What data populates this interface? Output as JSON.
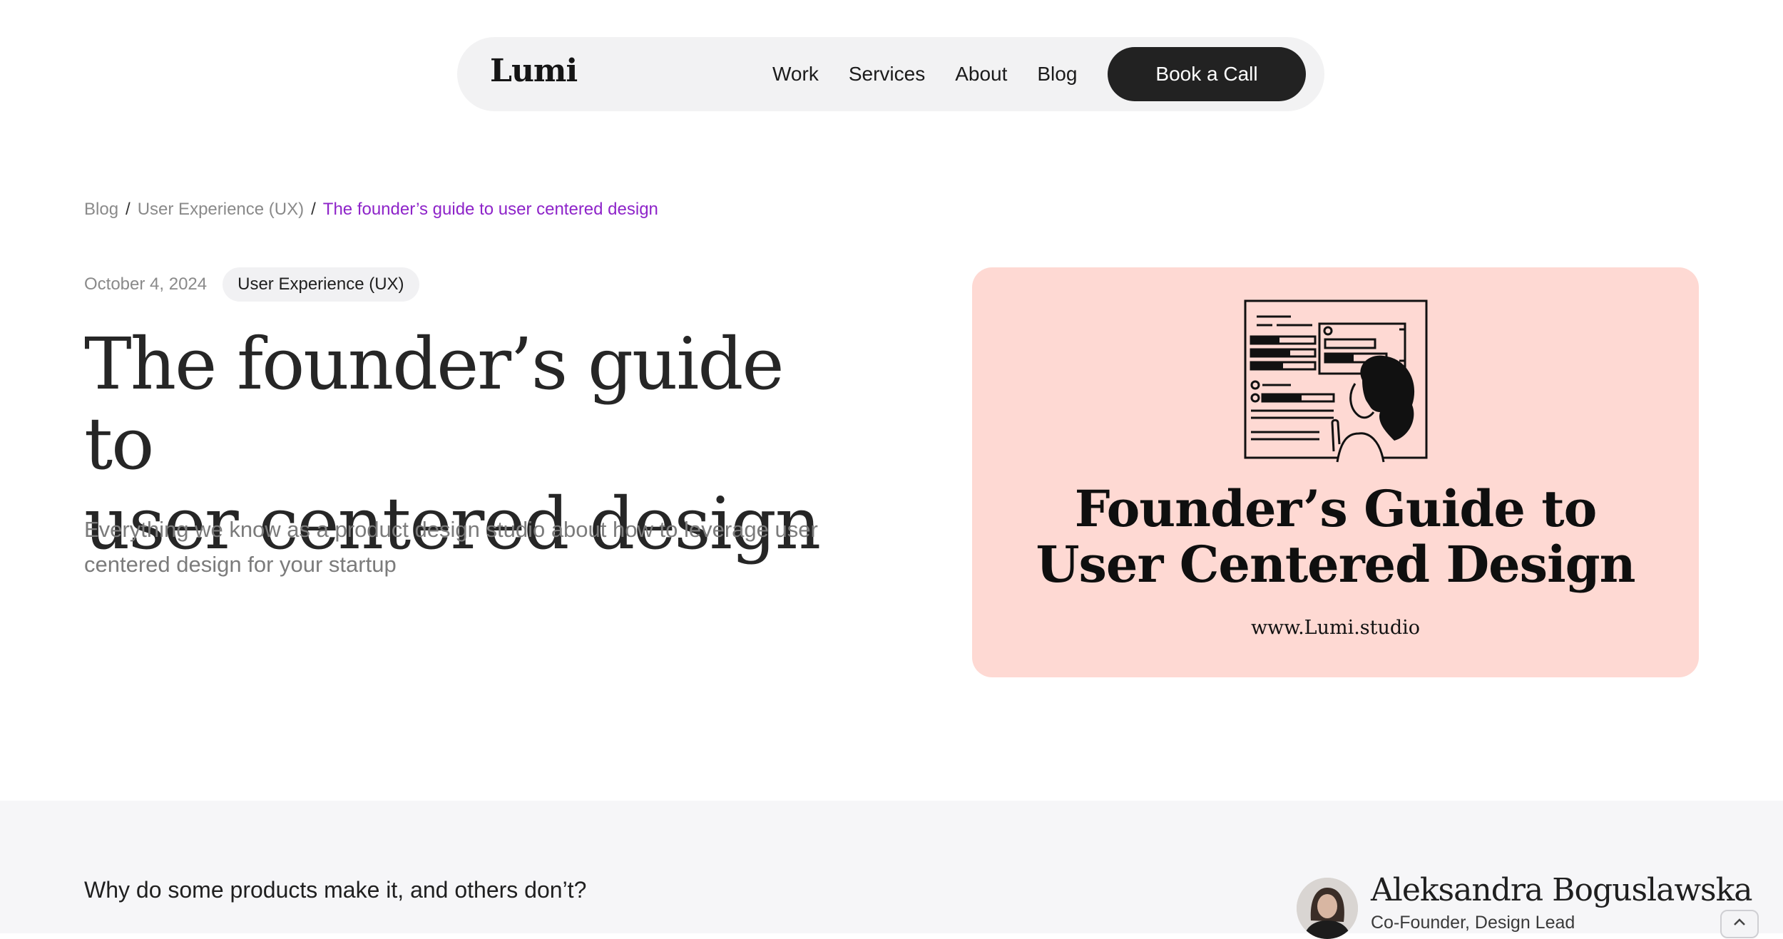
{
  "nav": {
    "logo": "Lumi",
    "links": [
      "Work",
      "Services",
      "About",
      "Blog"
    ],
    "cta": "Book a Call"
  },
  "breadcrumb": {
    "items": [
      "Blog",
      "User Experience (UX)"
    ],
    "separator": "/",
    "current": "The founder’s guide to user centered design"
  },
  "article": {
    "date": "October 4, 2024",
    "tag": "User Experience (UX)",
    "title_line1": "The founder’s guide to",
    "title_line2": "user centered design",
    "subtitle": "Everything we know as a product design studio about how to leverage user centered design for your startup"
  },
  "hero": {
    "heading_line1": "Founder’s Guide to",
    "heading_line2": "User Centered Design",
    "url": "www.Lumi.studio",
    "background": "#fed9d3"
  },
  "lower": {
    "question": "Why do some products make it, and others don’t?",
    "author_name": "Aleksandra Boguslawska",
    "author_role": "Co-Founder, Design Lead"
  },
  "colors": {
    "accent": "#8e24c9",
    "button": "#222222"
  },
  "icons": {
    "scroll_top": "chevron-up-icon"
  }
}
